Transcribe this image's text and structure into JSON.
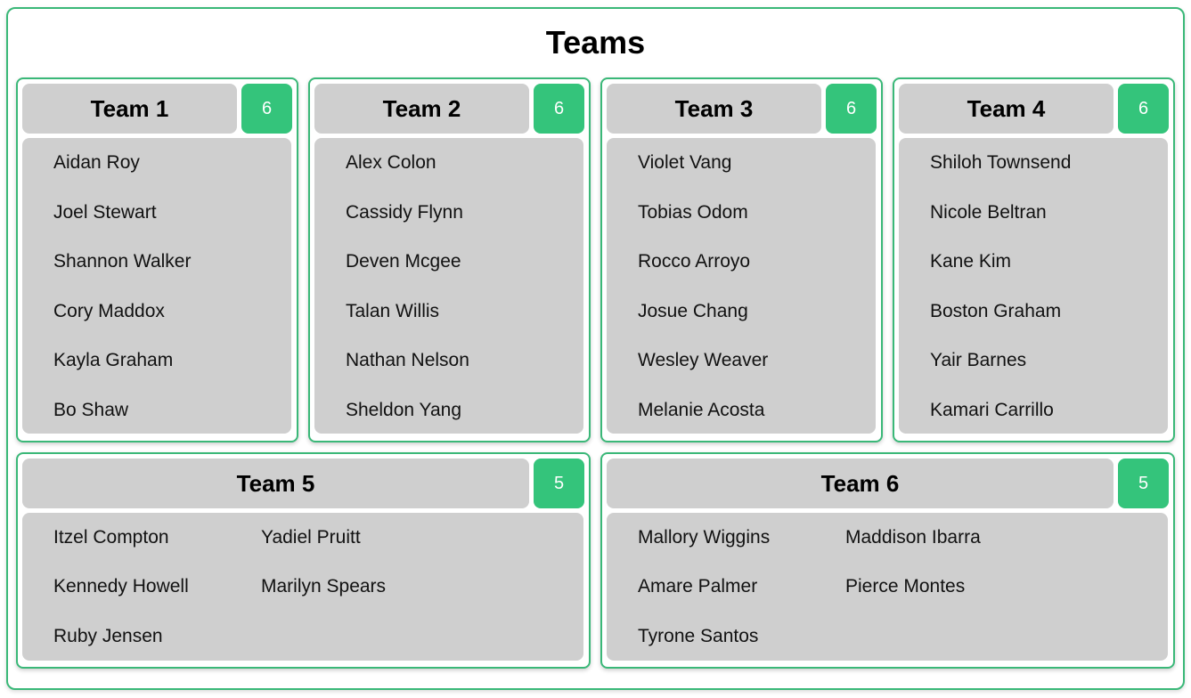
{
  "page": {
    "title": "Teams"
  },
  "teams": [
    {
      "name": "Team 1",
      "count": "6",
      "members": [
        "Aidan Roy",
        "Joel Stewart",
        "Shannon Walker",
        "Cory Maddox",
        "Kayla Graham",
        "Bo Shaw"
      ]
    },
    {
      "name": "Team 2",
      "count": "6",
      "members": [
        "Alex Colon",
        "Cassidy Flynn",
        "Deven Mcgee",
        "Talan Willis",
        "Nathan Nelson",
        "Sheldon Yang"
      ]
    },
    {
      "name": "Team 3",
      "count": "6",
      "members": [
        "Violet Vang",
        "Tobias Odom",
        "Rocco Arroyo",
        "Josue Chang",
        "Wesley Weaver",
        "Melanie Acosta"
      ]
    },
    {
      "name": "Team 4",
      "count": "6",
      "members": [
        "Shiloh Townsend",
        "Nicole Beltran",
        "Kane Kim",
        "Boston Graham",
        "Yair Barnes",
        "Kamari Carrillo"
      ]
    },
    {
      "name": "Team 5",
      "count": "5",
      "members": [
        "Itzel Compton",
        "Yadiel Pruitt",
        "Kennedy Howell",
        "Marilyn Spears",
        "Ruby Jensen"
      ]
    },
    {
      "name": "Team 6",
      "count": "5",
      "members": [
        "Mallory Wiggins",
        "Maddison Ibarra",
        "Amare Palmer",
        "Pierce Montes",
        "Tyrone Santos"
      ]
    }
  ],
  "colors": {
    "accent": "#34c47b",
    "border": "#3ab878",
    "panel": "#cfcfcf"
  }
}
